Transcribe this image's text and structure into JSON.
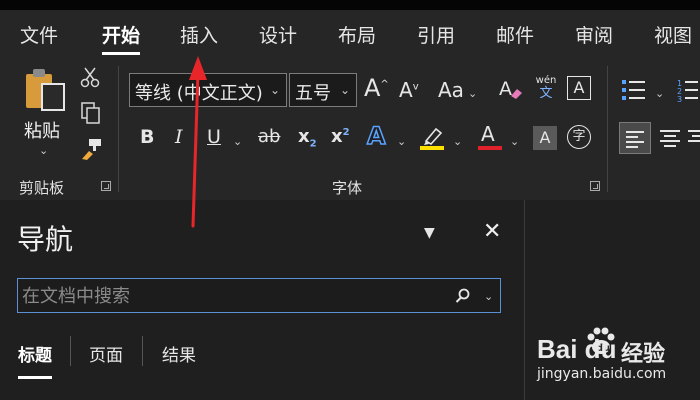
{
  "tabs": [
    {
      "label": "文件",
      "active": false
    },
    {
      "label": "开始",
      "active": true
    },
    {
      "label": "插入",
      "active": false
    },
    {
      "label": "设计",
      "active": false
    },
    {
      "label": "布局",
      "active": false
    },
    {
      "label": "引用",
      "active": false
    },
    {
      "label": "邮件",
      "active": false
    },
    {
      "label": "审阅",
      "active": false
    },
    {
      "label": "视图",
      "active": false
    }
  ],
  "clipboard": {
    "paste_label": "粘贴",
    "group_label": "剪贴板"
  },
  "font": {
    "font_name": "等线 (中文正文)",
    "font_size": "五号",
    "group_label": "字体",
    "bold": "B",
    "italic": "I",
    "underline": "U",
    "strike": "ab",
    "subscript": "x",
    "subscript_mark": "2",
    "superscript": "x",
    "superscript_mark": "2",
    "grow": "A",
    "shrink": "A",
    "case": "Aa",
    "phonetic_top": "wén",
    "phonetic_bottom": "文",
    "enclosed_char": "字",
    "border_char": "A",
    "effects_char": "A",
    "font_color_char": "A",
    "shading_char": "A",
    "highlight_color": "#ffe100",
    "font_color": "#e0202a"
  },
  "navigation": {
    "title": "导航",
    "search_placeholder": "在文档中搜索",
    "subtabs": [
      {
        "label": "标题",
        "active": true
      },
      {
        "label": "页面",
        "active": false
      },
      {
        "label": "结果",
        "active": false
      }
    ]
  },
  "watermark": {
    "brand": "Bai du",
    "suffix": "经验",
    "url": "jingyan.baidu.com"
  },
  "annotation_color": "#e8262a"
}
